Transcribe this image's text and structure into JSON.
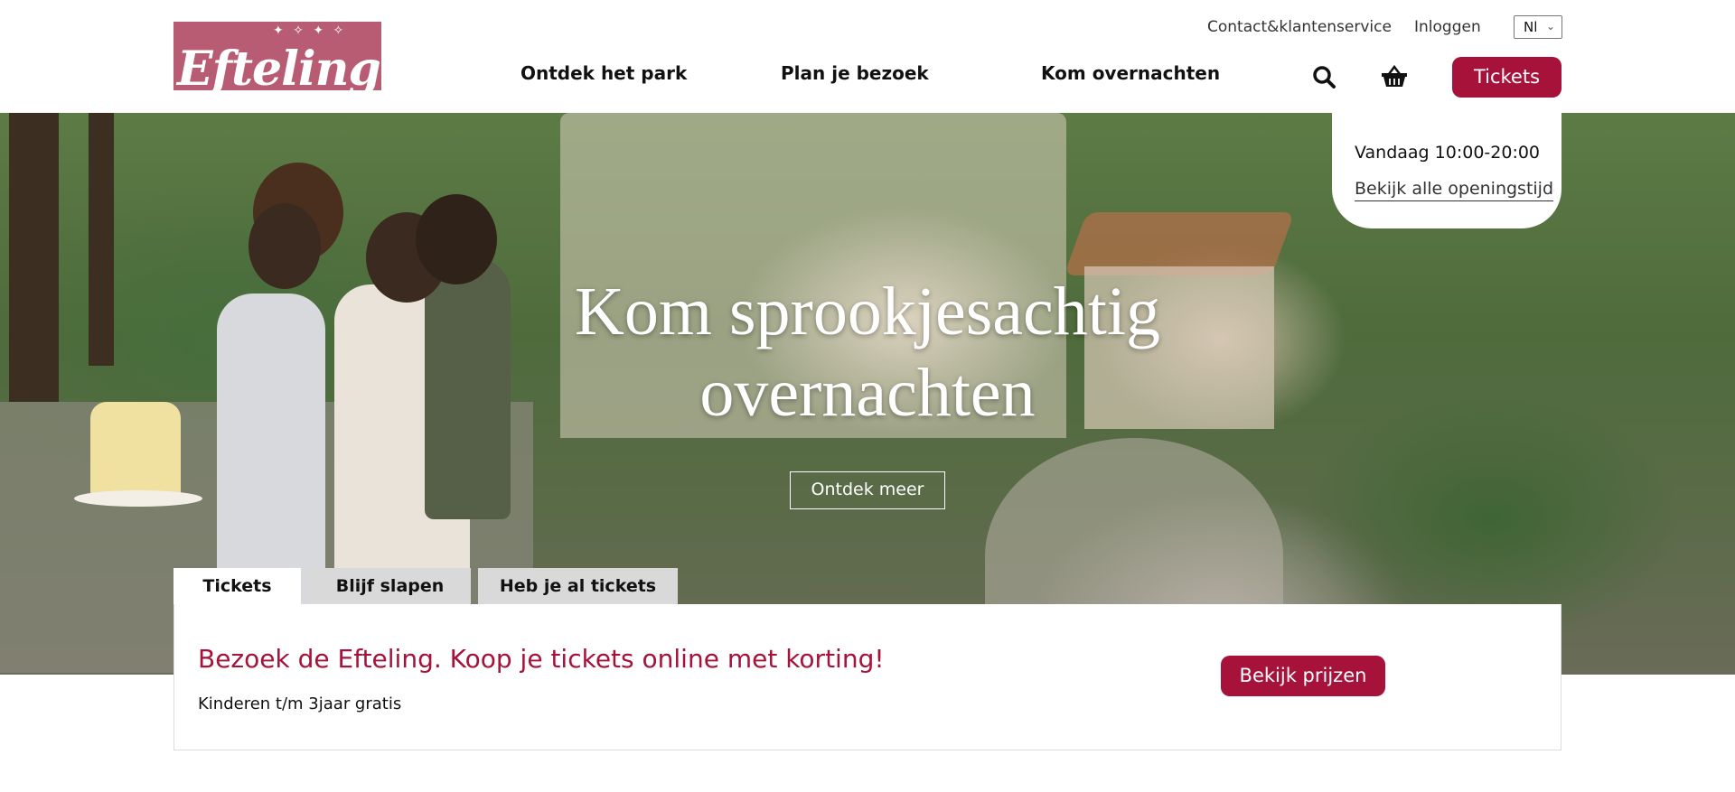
{
  "header": {
    "logo_text": "Efteling",
    "top_links": {
      "contact": "Contact&klantenservice",
      "login": "Inloggen"
    },
    "language": "Nl",
    "main_nav": [
      "Ontdek het park",
      "Plan je bezoek",
      "Kom overnachten"
    ],
    "tickets_label": "Tickets",
    "icons": [
      "search-icon",
      "basket-icon"
    ],
    "accent_color": "#a6123a"
  },
  "hours": {
    "today": "Vandaag 10:00-20:00",
    "link": "Bekijk alle openingstijd"
  },
  "hero": {
    "title_line1": "Kom sprookjesachtig",
    "title_line2": "overnachten",
    "button_label": "Ontdek meer"
  },
  "tabs": [
    {
      "label": "Tickets",
      "active": true
    },
    {
      "label": "Blijf slapen",
      "active": false
    },
    {
      "label": "Heb je al tickets",
      "active": false
    }
  ],
  "panel": {
    "title": "Bezoek de Efteling. Koop je tickets online met korting!",
    "subtitle": "Kinderen t/m 3jaar gratis",
    "button_label": "Bekijk prijzen"
  }
}
